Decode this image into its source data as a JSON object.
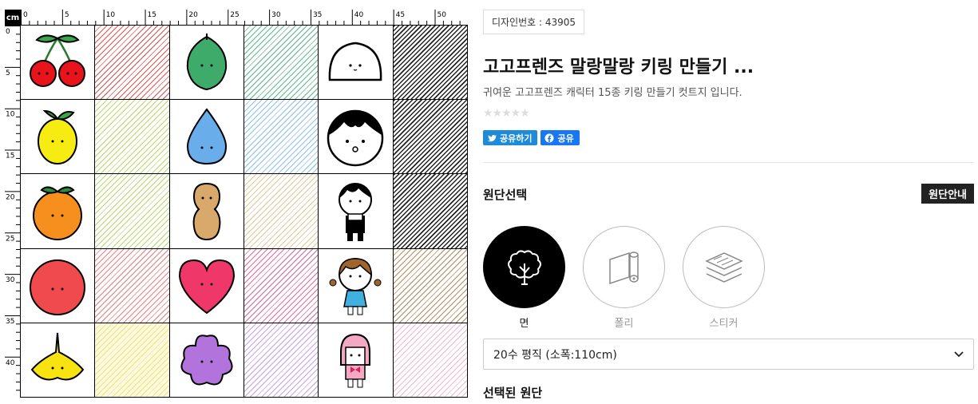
{
  "preview": {
    "unit_label": "cm",
    "top_ruler_labels": [
      "0",
      "5",
      "10",
      "15",
      "20",
      "25",
      "30",
      "35",
      "40",
      "45",
      "50"
    ],
    "left_ruler_labels": [
      "0",
      "5",
      "10",
      "15",
      "20",
      "25",
      "30",
      "35",
      "40"
    ],
    "pattern_cells": [
      {
        "icon": "cherry-icon"
      },
      {
        "icon": "red-hatch"
      },
      {
        "icon": "leaf-icon"
      },
      {
        "icon": "green-hatch"
      },
      {
        "icon": "rice-cake-icon"
      },
      {
        "icon": "black-hatch"
      },
      {
        "icon": "lemon-icon"
      },
      {
        "icon": "yellow-green-hatch"
      },
      {
        "icon": "water-drop-icon"
      },
      {
        "icon": "blue-hatch"
      },
      {
        "icon": "boy-face-icon"
      },
      {
        "icon": "black-hatch"
      },
      {
        "icon": "tangerine-icon"
      },
      {
        "icon": "yellow-green-hatch"
      },
      {
        "icon": "peanut-icon"
      },
      {
        "icon": "tan-hatch"
      },
      {
        "icon": "boy-character-icon"
      },
      {
        "icon": "black-hatch"
      },
      {
        "icon": "apple-icon"
      },
      {
        "icon": "red-hatch"
      },
      {
        "icon": "heart-icon"
      },
      {
        "icon": "pink-hatch"
      },
      {
        "icon": "girl-character-icon"
      },
      {
        "icon": "brown-hatch"
      },
      {
        "icon": "ginkgo-leaf-icon"
      },
      {
        "icon": "yellow-hatch"
      },
      {
        "icon": "flower-icon"
      },
      {
        "icon": "purple-hatch"
      },
      {
        "icon": "rabbit-character-icon"
      },
      {
        "icon": "light-pink-hatch"
      }
    ]
  },
  "product": {
    "design_code": "디자인번호 : 43905",
    "title": "고고프렌즈 말랑말랑 키링 만들기 ...",
    "description": "귀여운 고고프렌즈 캐릭터 15종 키링 만들기 컷트지 입니다.",
    "stars": "★★★★★",
    "share_twitter": "공유하기",
    "share_facebook": "공유"
  },
  "fabric_section": {
    "title": "원단선택",
    "guide_button": "원단안내",
    "options": [
      {
        "label": "면",
        "icon": "cotton-tree-icon",
        "active": true
      },
      {
        "label": "폴리",
        "icon": "fabric-roll-icon",
        "active": false
      },
      {
        "label": "스티커",
        "icon": "sticker-layers-icon",
        "active": false
      }
    ],
    "selected_value": "20수 평직 (소폭:110cm)"
  },
  "selected_section": {
    "title": "선택된 원단"
  },
  "colors": {
    "accent": "#222222",
    "twitter": "#1d8bd9",
    "facebook": "#1877f2"
  }
}
